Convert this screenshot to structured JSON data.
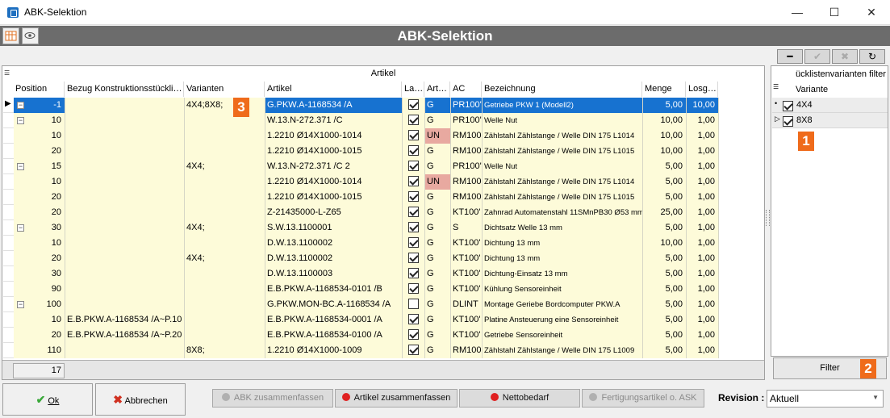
{
  "window": {
    "title": "ABK-Selektion",
    "minimize": "—",
    "maximize": "☐",
    "close": "✕"
  },
  "header": {
    "title": "ABK-Selektion"
  },
  "grid": {
    "group_header": "Artikel",
    "columns": [
      "Position",
      "Bezug Konstruktionsstückli…",
      "Varianten",
      "Artikel",
      "La…",
      "Art…",
      "AC",
      "Bezeichnung",
      "Menge",
      "Losg…"
    ],
    "rows": [
      {
        "level": 0,
        "exp": "−",
        "pos": "-1",
        "bezug": "",
        "var": "4X4;8X8;",
        "artikel": "G.PKW.A-1168534 /A",
        "la": true,
        "art": "G",
        "ac": "PR100'",
        "bez": "Getriebe PKW 1 (Modell2)",
        "menge": "5,00",
        "losg": "10,00",
        "selected": true,
        "ac_hl": false,
        "art_hl": false
      },
      {
        "level": 1,
        "exp": "−",
        "pos": "10",
        "bezug": "",
        "var": "",
        "artikel": "W.13.N-272.371 /C",
        "la": true,
        "art": "G",
        "ac": "PR100'",
        "bez": "Welle Nut",
        "menge": "10,00",
        "losg": "1,00"
      },
      {
        "level": 2,
        "exp": "",
        "pos": "10",
        "bezug": "",
        "var": "",
        "artikel": "1.2210 Ø14X1000-1014",
        "la": true,
        "art": "UN",
        "ac": "RM100",
        "bez": "Zählstahl Zählstange / Welle DIN 175 L1014",
        "menge": "10,00",
        "losg": "1,00",
        "art_hl": true
      },
      {
        "level": 2,
        "exp": "",
        "pos": "20",
        "bezug": "",
        "var": "",
        "artikel": "1.2210 Ø14X1000-1015",
        "la": true,
        "art": "G",
        "ac": "RM100",
        "bez": "Zählstahl Zählstange / Welle DIN 175 L1015",
        "menge": "10,00",
        "losg": "1,00"
      },
      {
        "level": 1,
        "exp": "−",
        "pos": "15",
        "bezug": "",
        "var": "4X4;",
        "artikel": "W.13.N-272.371 /C 2",
        "la": true,
        "art": "G",
        "ac": "PR100'",
        "bez": "Welle Nut",
        "menge": "5,00",
        "losg": "1,00"
      },
      {
        "level": 2,
        "exp": "",
        "pos": "10",
        "bezug": "",
        "var": "",
        "artikel": "1.2210 Ø14X1000-1014",
        "la": true,
        "art": "UN",
        "ac": "RM100",
        "bez": "Zählstahl Zählstange / Welle DIN 175 L1014",
        "menge": "5,00",
        "losg": "1,00",
        "art_hl": true
      },
      {
        "level": 2,
        "exp": "",
        "pos": "20",
        "bezug": "",
        "var": "",
        "artikel": "1.2210 Ø14X1000-1015",
        "la": true,
        "art": "G",
        "ac": "RM100",
        "bez": "Zählstahl Zählstange / Welle DIN 175 L1015",
        "menge": "5,00",
        "losg": "1,00"
      },
      {
        "level": 1,
        "exp": "",
        "pos": "20",
        "bezug": "",
        "var": "",
        "artikel": "Z-21435000-L-Z65",
        "la": true,
        "art": "G",
        "ac": "KT100'",
        "bez": "Zahnrad Automatenstahl 11SMnPB30 Ø53 mm, ",
        "menge": "25,00",
        "losg": "1,00"
      },
      {
        "level": 1,
        "exp": "−",
        "pos": "30",
        "bezug": "",
        "var": "4X4;",
        "artikel": "S.W.13.1100001",
        "la": true,
        "art": "G",
        "ac": "S",
        "bez": "Dichtsatz Welle 13 mm",
        "menge": "5,00",
        "losg": "1,00"
      },
      {
        "level": 2,
        "exp": "",
        "pos": "10",
        "bezug": "",
        "var": "",
        "artikel": "D.W.13.1100002",
        "la": true,
        "art": "G",
        "ac": "KT100'",
        "bez": "Dichtung 13 mm",
        "menge": "10,00",
        "losg": "1,00"
      },
      {
        "level": 2,
        "exp": "",
        "pos": "20",
        "bezug": "",
        "var": "4X4;",
        "artikel": "D.W.13.1100002",
        "la": true,
        "art": "G",
        "ac": "KT100'",
        "bez": "Dichtung 13 mm",
        "menge": "5,00",
        "losg": "1,00"
      },
      {
        "level": 2,
        "exp": "",
        "pos": "30",
        "bezug": "",
        "var": "",
        "artikel": "D.W.13.1100003",
        "la": true,
        "art": "G",
        "ac": "KT100'",
        "bez": "Dichtung-Einsatz 13 mm",
        "menge": "5,00",
        "losg": "1,00"
      },
      {
        "level": 1,
        "exp": "",
        "pos": "90",
        "bezug": "",
        "var": "",
        "artikel": "E.B.PKW.A-1168534-0101 /B",
        "la": true,
        "art": "G",
        "ac": "KT100'",
        "bez": "Kühlung Sensoreinheit",
        "menge": "5,00",
        "losg": "1,00"
      },
      {
        "level": 1,
        "exp": "−",
        "pos": "100",
        "bezug": "",
        "var": "",
        "artikel": "G.PKW.MON-BC.A-1168534 /A",
        "la": false,
        "art": "G",
        "ac": "DLINT",
        "bez": "Montage Geriebe Bordcomputer PKW.A",
        "menge": "5,00",
        "losg": "1,00"
      },
      {
        "level": 2,
        "exp": "",
        "pos": "10",
        "bezug": "E.B.PKW.A-1168534 /A~P.10",
        "var": "",
        "artikel": "E.B.PKW.A-1168534-0001 /A",
        "la": true,
        "art": "G",
        "ac": "KT100'",
        "bez": "Platine Ansteuerung eine Sensoreinheit",
        "menge": "5,00",
        "losg": "1,00"
      },
      {
        "level": 2,
        "exp": "",
        "pos": "20",
        "bezug": "E.B.PKW.A-1168534 /A~P.20",
        "var": "",
        "artikel": "E.B.PKW.A-1168534-0100 /A",
        "la": true,
        "art": "G",
        "ac": "KT100'",
        "bez": "Getriebe Sensoreinheit",
        "menge": "5,00",
        "losg": "1,00"
      },
      {
        "level": 1,
        "exp": "",
        "pos": "110",
        "bezug": "",
        "var": "8X8;",
        "artikel": "1.2210 Ø14X1000-1009",
        "la": true,
        "art": "G",
        "ac": "RM100",
        "bez": "Zählstahl Zählstange / Welle DIN 175 L1009",
        "menge": "5,00",
        "losg": "1,00"
      }
    ],
    "footer_count": "17"
  },
  "variants": {
    "header": "ücklistenvarianten filter",
    "column": "Variante",
    "items": [
      {
        "label": "4X4",
        "checked": true,
        "marker": "•"
      },
      {
        "label": "8X8",
        "checked": true,
        "marker": "▷"
      }
    ],
    "filter_label": "Filter"
  },
  "badges": {
    "b1": "1",
    "b2": "2",
    "b3": "3"
  },
  "buttons": {
    "ok": "Ok",
    "cancel": "Abbrechen",
    "abk_merge": "ABK zusammenfassen",
    "artikel_merge": "Artikel zusammenfassen",
    "netto": "Nettobedarf",
    "fertigung": "Fertigungsartikel o. ASK"
  },
  "revision": {
    "label": "Revision :",
    "value": "Aktuell"
  },
  "colors": {
    "accent": "#1772d0",
    "badge": "#ef6b1b",
    "row_bg": "#fdfbd9",
    "highlight": "#e8a9a0",
    "red_dot": "#e02020",
    "gray_dot": "#b0b0b0"
  }
}
